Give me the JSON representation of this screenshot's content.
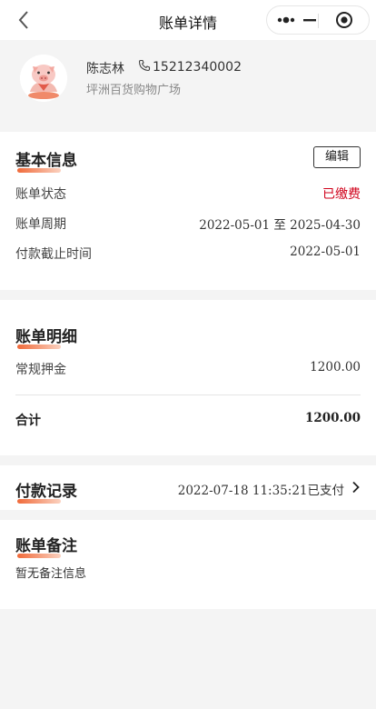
{
  "nav": {
    "title": "账单详情",
    "icons": {
      "back": "chevron-left-icon",
      "more": "more-dots-icon",
      "minimize": "minimize-icon",
      "close": "target-close-icon"
    }
  },
  "profile": {
    "name": "陈志林",
    "phone": "15212340002",
    "address": "坪洲百货购物广场",
    "avatar_icon": "pig-avatar-icon"
  },
  "basic": {
    "title": "基本信息",
    "edit_label": "编辑",
    "rows": [
      {
        "label": "账单状态",
        "value": "已缴费"
      },
      {
        "label": "账单周期",
        "value": "2022-05-01 至 2025-04-30"
      },
      {
        "label": "付款截止时间",
        "value": "2022-05-01"
      }
    ]
  },
  "detail": {
    "title": "账单明细",
    "items": [
      {
        "label": "常规押金",
        "value": "1200.00"
      }
    ],
    "total": {
      "label": "合计",
      "value": "1200.00"
    }
  },
  "payment": {
    "title": "付款记录",
    "summary": "2022-07-18 11:35:21已支付"
  },
  "remark": {
    "title": "账单备注",
    "text": "暂无备注信息"
  },
  "colors": {
    "status_paid": "#d0021b",
    "accent": "#f06a3a",
    "background": "#f4f4f4"
  }
}
